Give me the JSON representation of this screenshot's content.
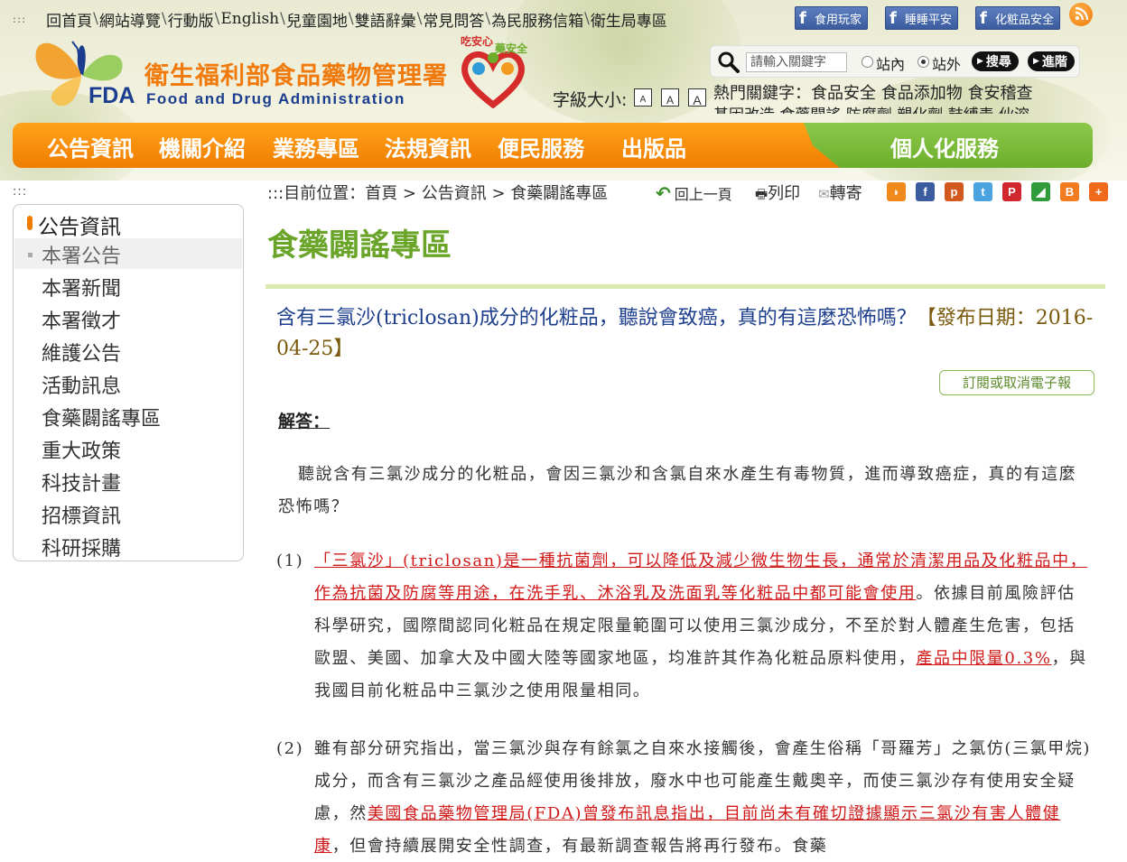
{
  "topbar": {
    "dots": ":::",
    "links": [
      "回首頁",
      "網站導覽",
      "行動版",
      "English",
      "兒童園地",
      "雙語辭彙",
      "常見問答",
      "為民服務信箱",
      "衛生局專區"
    ]
  },
  "social": {
    "fb1": "食用玩家",
    "fb2": "睡睡平安",
    "fb3": "化粧品安全",
    "fb_icon": "f",
    "rss_icon": "rss-icon"
  },
  "logo": {
    "title": "衛生福利部食品藥物管理署",
    "fda": "FDA",
    "sub": "Food and Drug Administration",
    "mascot_text": "吃安心 藥安全"
  },
  "search": {
    "placeholder": "請輸入關鍵字",
    "opt_site_in": "站內",
    "opt_site_out": "站外",
    "btn_search": "搜尋",
    "btn_advanced": "進階",
    "selected": "站外"
  },
  "font_size": {
    "label": "字級大小:",
    "boxes": [
      "A",
      "A",
      "A"
    ]
  },
  "hot": {
    "label": "熱門關鍵字：",
    "line1": "食品安全 食品添加物 食安稽查",
    "line2": "基因改造 食藥闢謠 防腐劑 塑化劑 鼓縛毒 伙溶"
  },
  "nav": {
    "items": [
      "公告資訊",
      "機關介紹",
      "業務專區",
      "法規資訊",
      "便民服務",
      "出版品"
    ],
    "personal": "個人化服務"
  },
  "breadcrumb": {
    "dots": ":::",
    "text": ":::目前位置：首頁 > 公告資訊 > 食藥闢謠專區",
    "back": "回上一頁",
    "print": "列印",
    "forward": "轉寄"
  },
  "share": [
    {
      "name": "rss-share-icon",
      "label": "◗",
      "color": "#f08a1c"
    },
    {
      "name": "facebook-share-icon",
      "label": "f",
      "color": "#3b5c9e"
    },
    {
      "name": "plurk-share-icon",
      "label": "p",
      "color": "#d35a1e"
    },
    {
      "name": "twitter-share-icon",
      "label": "t",
      "color": "#4aa3df"
    },
    {
      "name": "pinterest-share-icon",
      "label": "P",
      "color": "#d0282c"
    },
    {
      "name": "google-share-icon",
      "label": "◢",
      "color": "#2f9b3a"
    },
    {
      "name": "blogger-share-icon",
      "label": "B",
      "color": "#f47c20"
    },
    {
      "name": "more-share-icon",
      "label": "+",
      "color": "#f06a1c"
    }
  ],
  "sidebar": {
    "title": "公告資訊",
    "items": [
      "本署公告",
      "本署新聞",
      "本署徵才",
      "維護公告",
      "活動訊息",
      "食藥闢謠專區",
      "重大政策",
      "科技計畫",
      "招標資訊",
      "科研採購"
    ]
  },
  "main": {
    "page_title": "食藥闢謠專區",
    "article_title": "含有三氯沙(triclosan)成分的化粧品，聽說會致癌，真的有這麼恐怖嗎？",
    "article_date": "【發布日期：2016-04-25】",
    "subscribe": "訂閱或取消電子報",
    "answer_label": "解答：",
    "intro": "聽說含有三氯沙成分的化粧品，會因三氯沙和含氯自來水產生有毒物質，進而導致癌症，真的有這麼恐怖嗎？",
    "item1_num": "(1)",
    "item1_red": "「三氯沙」(triclosan)是一種抗菌劑，可以降低及減少微生物生長，通常於清潔用品及化粧品中，作為抗菌及防腐等用途，在洗手乳、沐浴乳及洗面乳等化粧品中都可能會使用",
    "item1_mid": "。依據目前風險評估科學研究，國際間認同化粧品在規定限量範圍可以使用三氯沙成分，不至於對人體產生危害，包括歐盟、美國、加拿大及中國大陸等國家地區，均准許其作為化粧品原料使用，",
    "item1_red2": "產品中限量0.3%",
    "item1_end": "，與我國目前化粧品中三氯沙之使用限量相同。",
    "item2_num": "(2)",
    "item2_a": "雖有部分研究指出，當三氯沙與存有餘氯之自來水接觸後，會產生俗稱「哥羅芳」之氯仿(三氯甲烷)成分，而含有三氯沙之產品經使用後排放，廢水中也可能產生戴奧辛，而使三氯沙存有使用安全疑慮，然",
    "item2_red": "美國食品藥物管理局(FDA)曾發布訊息指出，目前尚未有確切證據顯示三氯沙有害人體健康",
    "item2_end": "，但會持續展開安全性調查，有最新調查報告將再行發布。食藥"
  }
}
